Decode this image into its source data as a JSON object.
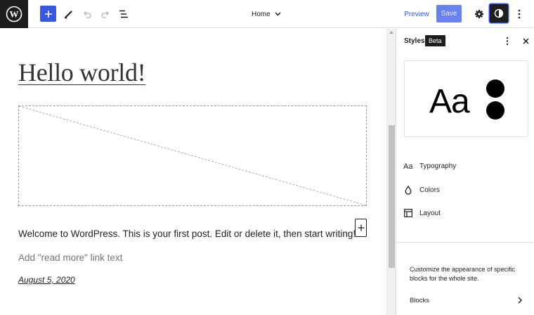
{
  "toolbar": {
    "logo_icon": "wordpress-logo",
    "document_title": "Home",
    "preview_label": "Preview",
    "save_label": "Save",
    "accent_color": "#3858e9"
  },
  "canvas": {
    "post_title": "Hello world!",
    "excerpt": "Welcome to WordPress. This is your first post. Edit or delete it, then start writing!",
    "read_more_placeholder": "Add \"read more\" link text",
    "post_date": "August 5, 2020"
  },
  "sidebar": {
    "title": "Styles",
    "badge": "Beta",
    "preview_text": "Aa",
    "nav": [
      {
        "label": "Typography",
        "icon": "typography-icon"
      },
      {
        "label": "Colors",
        "icon": "droplet-icon"
      },
      {
        "label": "Layout",
        "icon": "layout-icon"
      }
    ],
    "description": "Customize the appearance of specific blocks for the whole site.",
    "blocks_label": "Blocks"
  }
}
